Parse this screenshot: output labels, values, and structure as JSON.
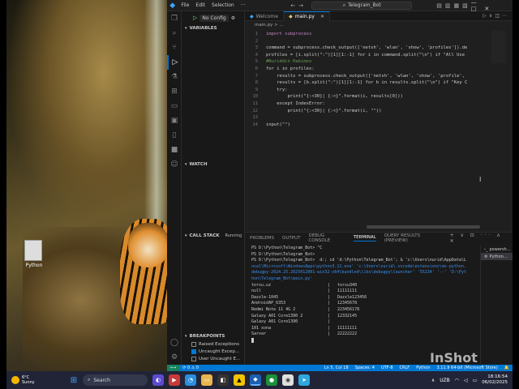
{
  "app": {
    "menu": [
      "File",
      "Edit",
      "Selection"
    ],
    "more": "···",
    "search_text": "Telegram_Bot",
    "window_controls": [
      "—",
      "□",
      "✕"
    ]
  },
  "sidebar": {
    "run_config": "No Config",
    "sections": {
      "variables": "VARIABLES",
      "watch": "WATCH",
      "call_stack": "CALL STACK",
      "call_stack_status": "Running",
      "breakpoints": "BREAKPOINTS"
    },
    "breakpoints": [
      {
        "label": "Raised Exceptions",
        "checked": false
      },
      {
        "label": "Uncaught Excep...",
        "checked": true
      },
      {
        "label": "User Uncaught E...",
        "checked": false
      }
    ]
  },
  "editor": {
    "tabs": [
      {
        "label": "Welcome",
        "active": false
      },
      {
        "label": "main.py",
        "active": true
      }
    ],
    "breadcrumb": "main.py > ...",
    "lines": [
      {
        "n": "1",
        "text": "import subprocess",
        "cls": "kw"
      },
      {
        "n": "2",
        "text": "",
        "cls": ""
      },
      {
        "n": "3",
        "text": "command = subprocess.check_output(['netsh', 'wlan', 'show', 'profiles']).de",
        "cls": ""
      },
      {
        "n": "4",
        "text": "profiles = [i.split(\":\")[1][1:-1] for i in command.split(\"\\n\") if \"All Use",
        "cls": ""
      },
      {
        "n": "5",
        "text": "#Nuriddin Hakimov",
        "cls": "cm"
      },
      {
        "n": "6",
        "text": "for i in profiles:",
        "cls": ""
      },
      {
        "n": "7",
        "text": "    results = subprocess.check_output(['netsh', 'wlan', 'show', 'profile',",
        "cls": ""
      },
      {
        "n": "8",
        "text": "    results = [b.split(\":\")[1][1:-1] for b in results.split(\"\\n\") if \"Key C",
        "cls": ""
      },
      {
        "n": "9",
        "text": "    try:",
        "cls": ""
      },
      {
        "n": "10",
        "text": "        print(\"{:<30}| {:<}\".format(i, results[0]))",
        "cls": ""
      },
      {
        "n": "11",
        "text": "    except IndexError:",
        "cls": ""
      },
      {
        "n": "12",
        "text": "        print(\"{:<30}| {:<}\".format(i, \"\"))",
        "cls": ""
      },
      {
        "n": "13",
        "text": "",
        "cls": ""
      },
      {
        "n": "14",
        "text": "input(\"\")",
        "cls": ""
      }
    ]
  },
  "panel": {
    "tabs": [
      {
        "label": "PROBLEMS",
        "active": false
      },
      {
        "label": "OUTPUT",
        "active": false
      },
      {
        "label": "DEBUG CONSOLE",
        "active": false
      },
      {
        "label": "TERMINAL",
        "active": true
      },
      {
        "label": "QUERY RESULTS (PREVIEW)",
        "active": false
      }
    ],
    "actions": "+ ∨ ⊡ ··· ∧ ✕",
    "terminal_lines": [
      {
        "text": "PS D:\\Python\\Telegram_Bot> ^C",
        "cls": ""
      },
      {
        "text": "PS D:\\Python\\Telegram_Bot>",
        "cls": ""
      },
      {
        "text": "PS D:\\Python\\Telegram_Bot>  d:; cd 'd:\\Python\\Telegram_Bot'; & 'c:\\Users\\nurid\\AppData\\L",
        "cls": ""
      },
      {
        "text": "ocal\\Microsoft\\WindowsApps\\python3.11.exe' 'c:\\Users\\nurid\\.vscode\\extensions\\ms-python.",
        "cls": "path"
      },
      {
        "text": "debugpy-2024.25.2025012001-win32-x64\\bundled\\libs\\debugpy\\launcher' '55234' '--' 'D:\\Pyt",
        "cls": "path"
      },
      {
        "text": "hon\\Telegram_Bot\\main.py'",
        "cls": "path"
      }
    ],
    "wifi_rows": [
      {
        "name": "torsu.uz",
        "key": "torsu340"
      },
      {
        "name": "null",
        "key": "11111111"
      },
      {
        "name": "Dazzle-1045",
        "key": "Dazzle123456"
      },
      {
        "name": "AndroidAP_6353",
        "key": "12345678"
      },
      {
        "name": "Redmi Note 11 4G 2",
        "key": "223456178"
      },
      {
        "name": "Galaxy A01 Core1390 2",
        "key": "12332145"
      },
      {
        "name": "Galaxy A01 Core1390",
        "key": ""
      },
      {
        "name": "101 xona",
        "key": "11111111"
      },
      {
        "name": "Sarvar",
        "key": "22222222"
      }
    ],
    "terminal_list": [
      {
        "label": "powersh...",
        "active": false
      },
      {
        "label": "Python...",
        "active": true
      }
    ]
  },
  "status": {
    "left": "⟳ 0 ⚠ 0",
    "cursor": "Ln 5, Col 18",
    "spaces": "Spaces: 4",
    "encoding": "UTF-8",
    "eol": "CRLF",
    "language": "Python",
    "interpreter": "3.11.9 64-bit (Microsoft Store)"
  },
  "taskbar": {
    "temp": "6°C",
    "weather": "Sunny",
    "search": "Search",
    "lang": "UZB",
    "time": "18:16:54",
    "date": "06/02/2025"
  },
  "watermark": "InShot",
  "desktop_icon_label": "Python"
}
